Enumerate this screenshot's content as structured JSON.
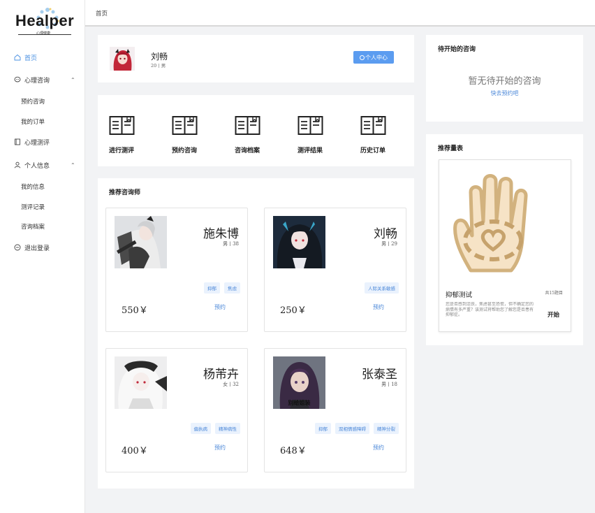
{
  "brand": {
    "name": "Healper",
    "sub": "心理健康"
  },
  "header": {
    "breadcrumb": "首页"
  },
  "sidebar": {
    "home": "首页",
    "consult": "心理咨询",
    "consult_sub": [
      "预约咨询",
      "我的订单"
    ],
    "test": "心理测评",
    "personal": "个人信息",
    "personal_sub": [
      "我的信息",
      "测评记录",
      "咨询档案"
    ],
    "logout": "退出登录"
  },
  "profile": {
    "name": "刘畅",
    "meta": "20丨男",
    "button": "个人中心"
  },
  "quick_actions": [
    "进行测评",
    "预约咨询",
    "咨询档案",
    "测评结果",
    "历史订单"
  ],
  "counselors": {
    "title": "推荐咨询师",
    "book_label": "预约",
    "items": [
      {
        "name": "施朱博",
        "meta": "男丨38",
        "tags": [
          "抑郁",
          "焦虑"
        ],
        "price": "550￥"
      },
      {
        "name": "刘畅",
        "meta": "男丨29",
        "tags": [
          "人际关系敏感"
        ],
        "price": "250￥"
      },
      {
        "name": "杨芾卉",
        "meta": "女丨32",
        "tags": [
          "偏执病",
          "精神病性"
        ],
        "price": "400￥"
      },
      {
        "name": "张泰圣",
        "meta": "男丨18",
        "tags": [
          "抑郁",
          "双相情感障碍",
          "精神分裂"
        ],
        "price": "648￥",
        "avatar_caption": "别给姐装"
      }
    ]
  },
  "pending": {
    "title": "待开始的咨询",
    "empty": "暂无待开始的咨询",
    "link": "快去预约吧"
  },
  "recommend": {
    "title": "推荐量表",
    "scale_name": "抑郁测试",
    "scale_count": "共15题目",
    "scale_desc": "您是否感到沮丧，焦虑甚至恐慌，但不确定您的病情有多严重？该测试将帮助您了解您是否患有抑郁症。",
    "start": "开始"
  },
  "colors": {
    "accent": "#5b9cf0",
    "link": "#4a87d8",
    "hand_fill": "#f6e3c6",
    "hand_stroke": "#d2b27e"
  }
}
